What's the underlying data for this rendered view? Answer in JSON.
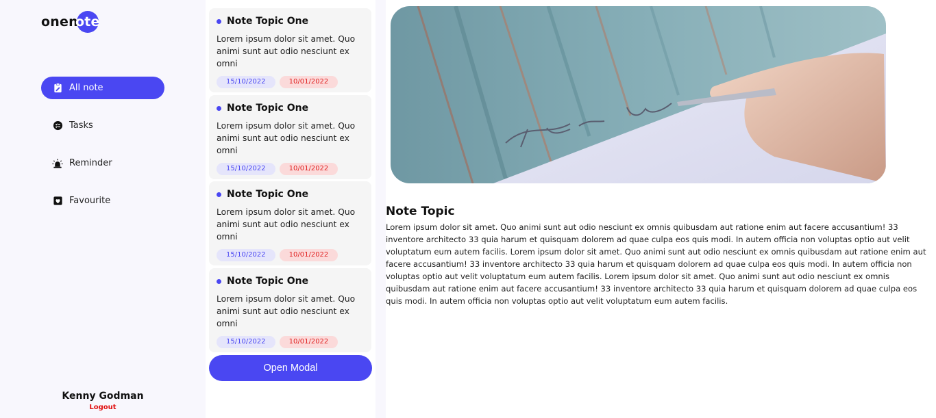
{
  "logo": {
    "text_before": "onen",
    "text_circle": "ote",
    "brand_color": "#4a47f2"
  },
  "nav": [
    {
      "label": "All note",
      "icon": "note-edit-icon",
      "active": true
    },
    {
      "label": "Tasks",
      "icon": "tasks-icon",
      "active": false
    },
    {
      "label": "Reminder",
      "icon": "alarm-icon",
      "active": false
    },
    {
      "label": "Favourite",
      "icon": "heart-icon",
      "active": false
    }
  ],
  "user": {
    "name": "Kenny Godman",
    "logout_label": "Logout"
  },
  "notes": [
    {
      "title": "Note Topic One",
      "text": "Lorem ipsum dolor sit amet. Quo animi sunt aut odio nesciunt ex omni",
      "date_start": "15/10/2022",
      "date_end": "10/01/2022"
    },
    {
      "title": "Note Topic One",
      "text": "Lorem ipsum dolor sit amet. Quo animi sunt aut odio nesciunt ex omni",
      "date_start": "15/10/2022",
      "date_end": "10/01/2022"
    },
    {
      "title": "Note Topic One",
      "text": "Lorem ipsum dolor sit amet. Quo animi sunt aut odio nesciunt ex omni",
      "date_start": "15/10/2022",
      "date_end": "10/01/2022"
    },
    {
      "title": "Note Topic One",
      "text": "Lorem ipsum dolor sit amet. Quo animi sunt aut odio nesciunt ex omni",
      "date_start": "15/10/2022",
      "date_end": "10/01/2022"
    }
  ],
  "open_modal_label": "Open Modal",
  "detail": {
    "title": "Note Topic",
    "body": "Lorem ipsum dolor sit amet. Quo animi sunt aut odio nesciunt ex omnis quibusdam aut ratione enim aut facere accusantium! 33 inventore architecto 33 quia harum et quisquam dolorem ad quae culpa eos quis modi. In autem officia non voluptas optio aut velit voluptatum eum autem facilis. Lorem ipsum dolor sit amet. Quo animi sunt aut odio nesciunt ex omnis quibusdam aut ratione enim aut facere accusantium! 33 inventore architecto 33 quia harum et quisquam dolorem ad quae culpa eos quis modi. In autem officia non voluptas optio aut velit voluptatum eum autem facilis. Lorem ipsum dolor sit amet. Quo animi sunt aut odio nesciunt ex omnis quibusdam aut ratione enim aut facere accusantium! 33 inventore architecto 33 quia harum et quisquam dolorem ad quae culpa eos quis modi. In autem officia non voluptas optio aut velit voluptatum eum autem facilis.",
    "image_handwriting": "Thank you"
  }
}
